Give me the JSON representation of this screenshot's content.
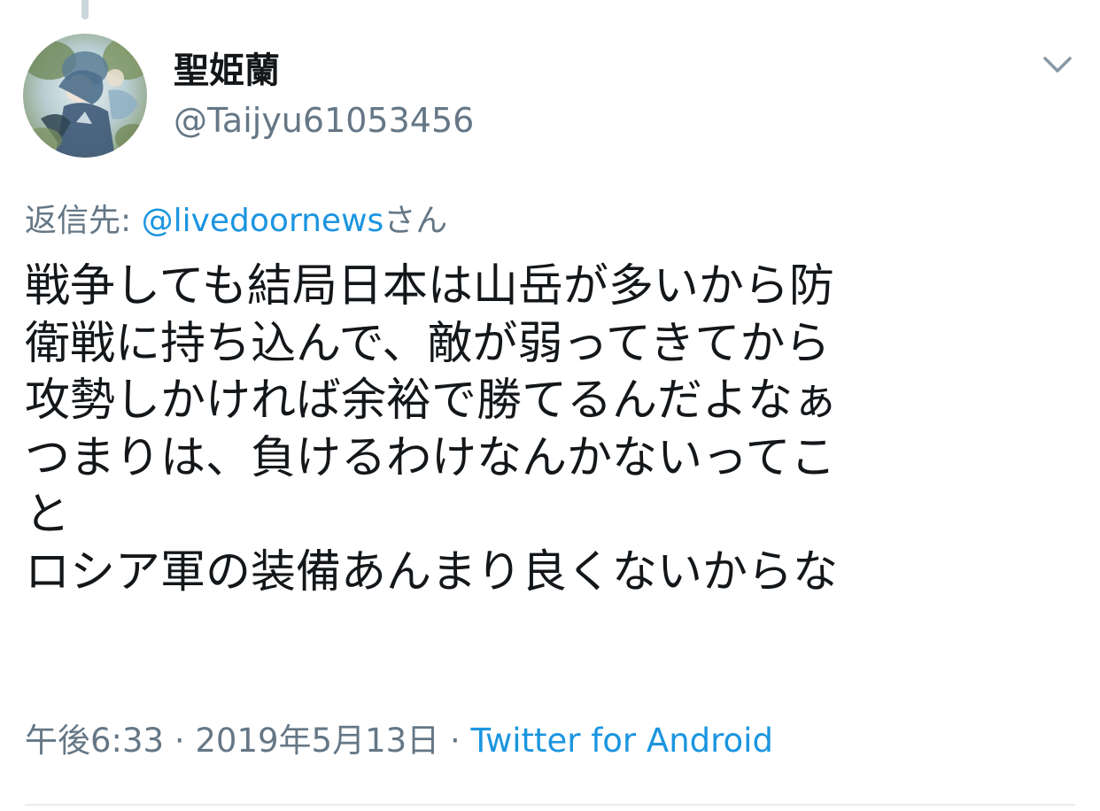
{
  "author": {
    "display_name": "聖姫蘭",
    "handle": "@Taijyu61053456",
    "avatar_icon": "avatar-image"
  },
  "menu": {
    "icon": "chevron-down-icon"
  },
  "reply": {
    "prefix": "返信先: ",
    "mention": "@livedoornews",
    "suffix": "さん"
  },
  "tweet": {
    "lines": [
      "戦争しても結局日本は山岳が多いから防",
      "衛戦に持ち込んで、敵が弱ってきてから",
      "攻勢しかければ余裕で勝てるんだよなぁ",
      "つまりは、負けるわけなんかないってこ",
      "と",
      "ロシア軍の装備あんまり良くないからな"
    ]
  },
  "meta": {
    "time": "午後6:33",
    "separator1": " · ",
    "date": "2019年5月13日",
    "separator2": " · ",
    "source": "Twitter for Android"
  },
  "colors": {
    "text": "#14171a",
    "secondary": "#657786",
    "link": "#1b95e0",
    "divider": "#e6ecf0"
  }
}
